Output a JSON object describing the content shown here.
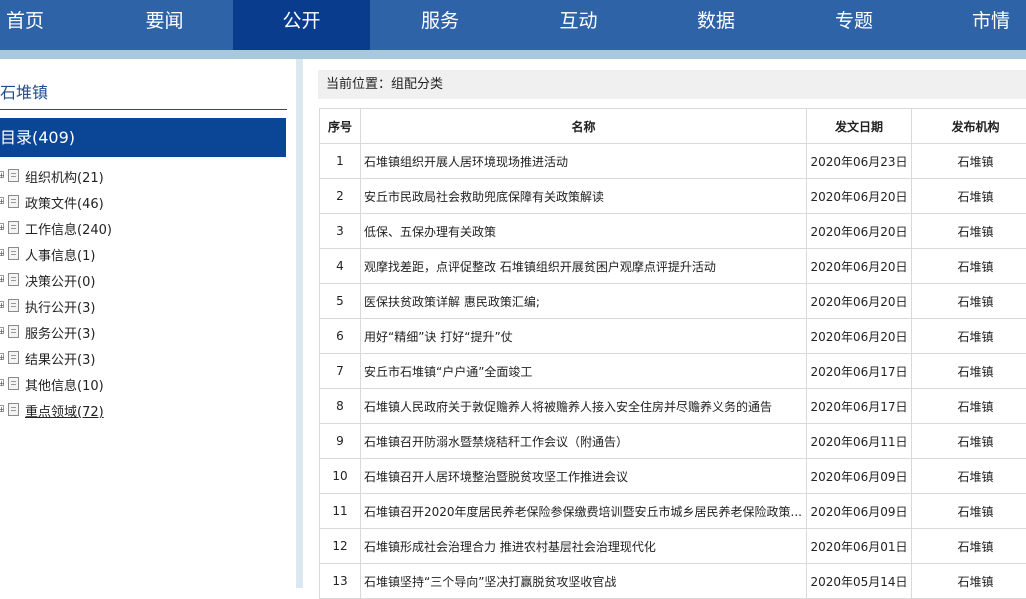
{
  "nav": {
    "items": [
      {
        "label": "首页"
      },
      {
        "label": "要闻"
      },
      {
        "label": "公开"
      },
      {
        "label": "服务"
      },
      {
        "label": "互动"
      },
      {
        "label": "数据"
      },
      {
        "label": "专题"
      },
      {
        "label": "市情"
      }
    ],
    "active": "公开"
  },
  "sidebar": {
    "town": "石堆镇",
    "directory": "目录(409)",
    "items": [
      {
        "label": "组织机构(21)"
      },
      {
        "label": "政策文件(46)"
      },
      {
        "label": "工作信息(240)"
      },
      {
        "label": "人事信息(1)"
      },
      {
        "label": "决策公开(0)"
      },
      {
        "label": "执行公开(3)"
      },
      {
        "label": "服务公开(3)"
      },
      {
        "label": "结果公开(3)"
      },
      {
        "label": "其他信息(10)"
      },
      {
        "label": "重点领域(72)"
      }
    ]
  },
  "breadcrumb": "当前位置：组配分类",
  "table": {
    "headers": [
      "序号",
      "名称",
      "发文日期",
      "发布机构"
    ],
    "rows": [
      {
        "num": "1",
        "name": "石堆镇组织开展人居环境现场推进活动",
        "date": "2020年06月23日",
        "org": "石堆镇"
      },
      {
        "num": "2",
        "name": "安丘市民政局社会救助兜底保障有关政策解读",
        "date": "2020年06月20日",
        "org": "石堆镇"
      },
      {
        "num": "3",
        "name": "低保、五保办理有关政策",
        "date": "2020年06月20日",
        "org": "石堆镇"
      },
      {
        "num": "4",
        "name": "观摩找差距，点评促整改 石堆镇组织开展贫困户观摩点评提升活动",
        "date": "2020年06月20日",
        "org": "石堆镇"
      },
      {
        "num": "5",
        "name": "医保扶贫政策详解 惠民政策汇编;",
        "date": "2020年06月20日",
        "org": "石堆镇"
      },
      {
        "num": "6",
        "name": "用好“精细”诀 打好“提升”仗",
        "date": "2020年06月20日",
        "org": "石堆镇"
      },
      {
        "num": "7",
        "name": "安丘市石堆镇“户户通”全面竣工",
        "date": "2020年06月17日",
        "org": "石堆镇"
      },
      {
        "num": "8",
        "name": "石堆镇人民政府关于敦促赡养人将被赡养人接入安全住房并尽赡养义务的通告",
        "date": "2020年06月17日",
        "org": "石堆镇"
      },
      {
        "num": "9",
        "name": "石堆镇召开防溺水暨禁烧秸秆工作会议（附通告）",
        "date": "2020年06月11日",
        "org": "石堆镇"
      },
      {
        "num": "10",
        "name": "石堆镇召开人居环境整治暨脱贫攻坚工作推进会议",
        "date": "2020年06月09日",
        "org": "石堆镇"
      },
      {
        "num": "11",
        "name": "石堆镇召开2020年度居民养老保险参保缴费培训暨安丘市城乡居民养老保险政策...",
        "date": "2020年06月09日",
        "org": "石堆镇"
      },
      {
        "num": "12",
        "name": "石堆镇形成社会治理合力 推进农村基层社会治理现代化",
        "date": "2020年06月01日",
        "org": "石堆镇"
      },
      {
        "num": "13",
        "name": "石堆镇坚持“三个导向”坚决打赢脱贫攻坚收官战",
        "date": "2020年05月14日",
        "org": "石堆镇"
      }
    ]
  }
}
